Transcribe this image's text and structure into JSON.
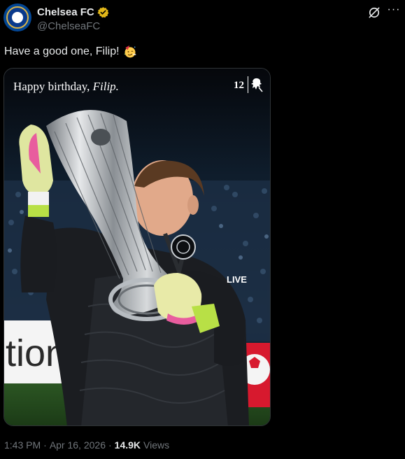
{
  "post": {
    "display_name": "Chelsea FC",
    "handle": "@ChelseaFC",
    "text": "Have a good one, Filip!",
    "emoji": "partying-face-emoji",
    "verified": true
  },
  "media": {
    "caption_prefix": "Happy birthday, ",
    "caption_name": "Filip.",
    "number": "12",
    "banner_text": "tion",
    "sponsor_text": "LIVE"
  },
  "meta": {
    "time": "1:43 PM",
    "separator": "·",
    "date": "Apr 16, 2026",
    "views_count": "14.9K",
    "views_label": "Views"
  },
  "icons": {
    "verified": "verified-badge-icon",
    "grok": "grok-icon",
    "more": "more-options-icon"
  },
  "colors": {
    "background": "#000000",
    "text": "#e7e9ea",
    "secondary_text": "#71767b",
    "verified_gold": "#e2b719",
    "chelsea_blue": "#034694"
  }
}
